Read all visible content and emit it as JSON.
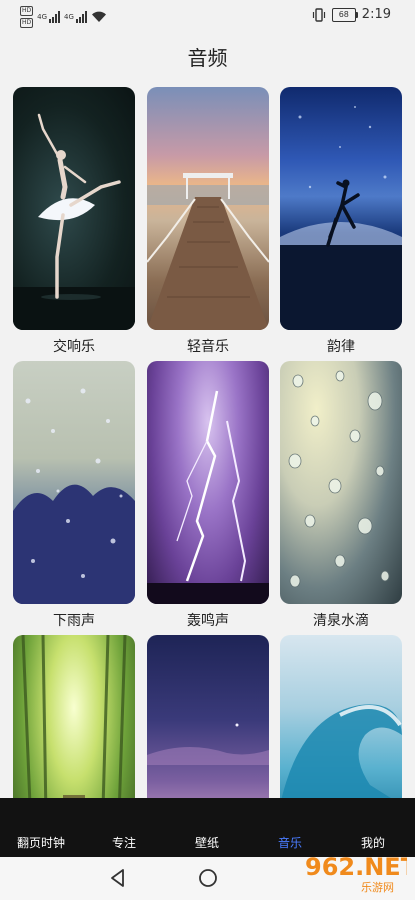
{
  "status_bar": {
    "hd_badges": [
      "HD",
      "HD"
    ],
    "network_badge": "4G",
    "battery_level": "68",
    "time": "2:19"
  },
  "page": {
    "title": "音频"
  },
  "cards": [
    {
      "label": "交响乐",
      "image": "ballet-dancer"
    },
    {
      "label": "轻音乐",
      "image": "pier-sunset"
    },
    {
      "label": "韵律",
      "image": "ocean-leap"
    },
    {
      "label": "下雨声",
      "image": "rain-window"
    },
    {
      "label": "轰鸣声",
      "image": "lightning-storm"
    },
    {
      "label": "清泉水滴",
      "image": "water-drops-glass"
    },
    {
      "label": "",
      "image": "bamboo-forest"
    },
    {
      "label": "",
      "image": "dusk-sky"
    },
    {
      "label": "",
      "image": "ocean-wave"
    }
  ],
  "bottom_nav": {
    "tabs": [
      {
        "label": "翻页时钟",
        "active": false
      },
      {
        "label": "专注",
        "active": false
      },
      {
        "label": "壁纸",
        "active": false
      },
      {
        "label": "音乐",
        "active": true
      },
      {
        "label": "我的",
        "active": false
      }
    ],
    "active_color": "#4a7cff",
    "background": "#121212"
  },
  "system_nav": {
    "buttons": [
      "back-icon",
      "home-icon"
    ]
  },
  "watermark": {
    "main": "962.NET",
    "sub": "乐游网"
  }
}
